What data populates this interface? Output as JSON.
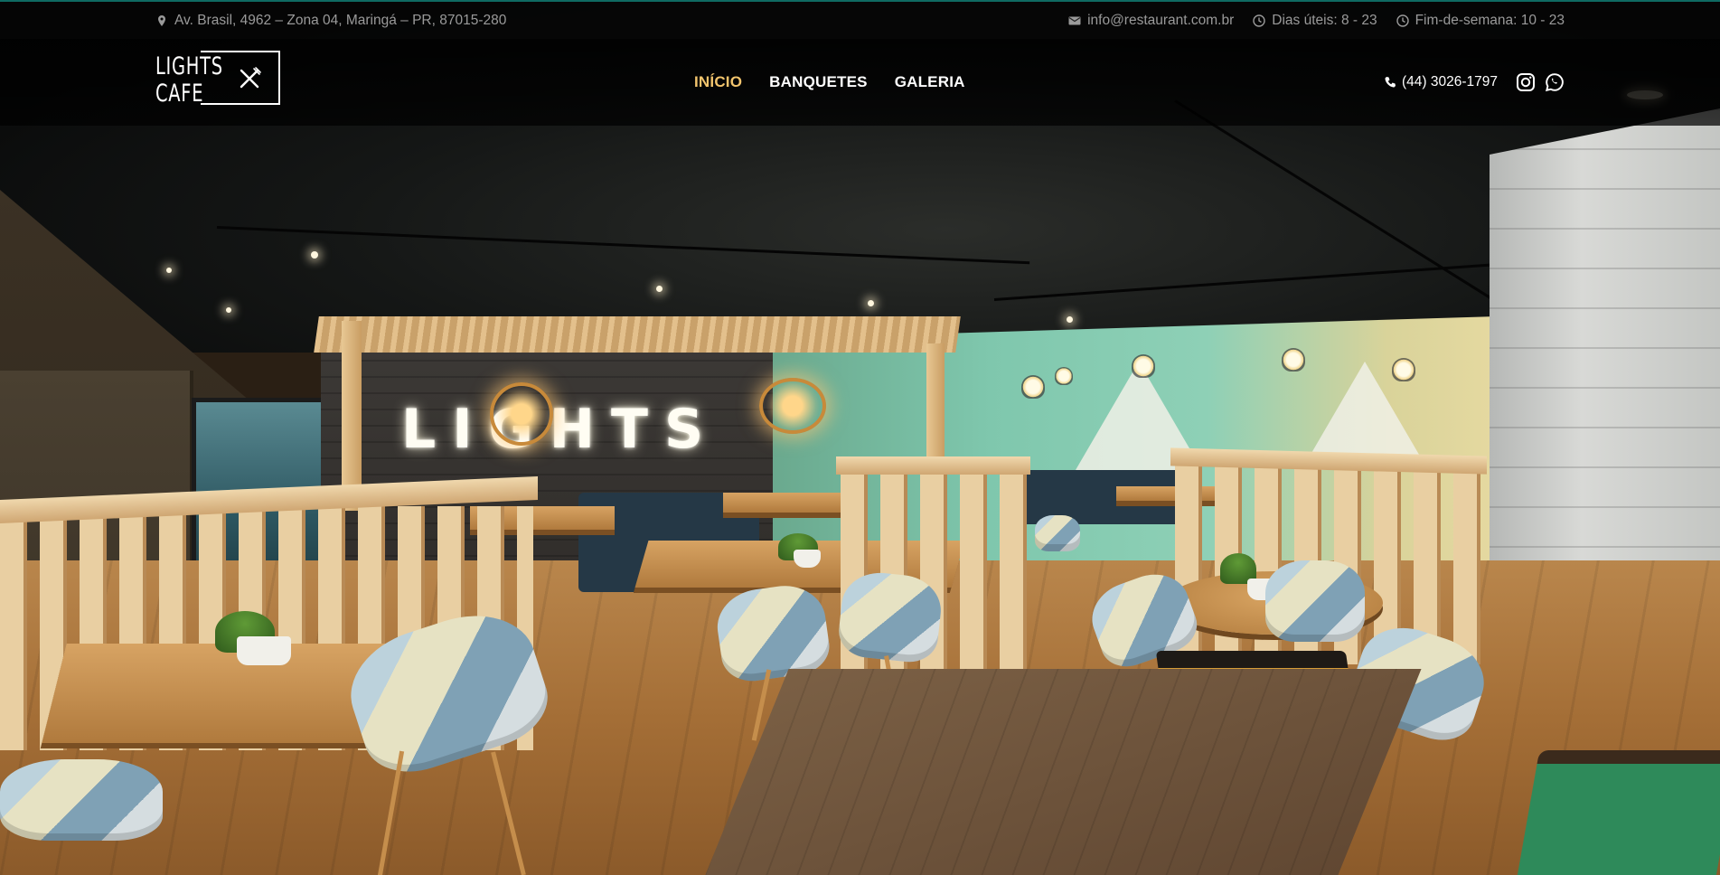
{
  "topbar": {
    "address": "Av. Brasil, 4962 – Zona 04, Maringá – PR, 87015-280",
    "email": "info@restaurant.com.br",
    "weekdays": "Dias úteis: 8 - 23",
    "weekend": "Fim-de-semana: 10 - 23",
    "icons": [
      "map-marker-icon",
      "envelope-icon",
      "clock-icon",
      "clock-icon"
    ]
  },
  "header": {
    "logo": {
      "line1": "LIGHTS",
      "line2": "CAFE",
      "icon": "fork-knife-icon"
    },
    "nav": [
      {
        "label": "INÍCIO",
        "active": true
      },
      {
        "label": "BANQUETES",
        "active": false
      },
      {
        "label": "GALERIA",
        "active": false
      }
    ],
    "phone": "(44) 3026-1797",
    "social": [
      "instagram-icon",
      "whatsapp-icon"
    ]
  },
  "hero": {
    "sign_text": "LIGHTS"
  },
  "colors": {
    "accent_active_nav": "#f2c46d",
    "topbar_text": "#9a9a9a",
    "topbar_border": "#0f6a62"
  }
}
